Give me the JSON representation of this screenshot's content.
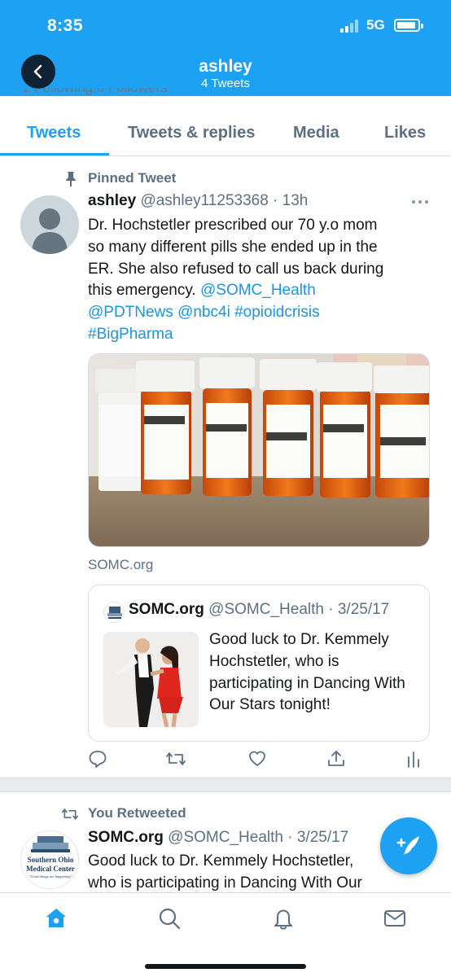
{
  "status": {
    "time": "8:35",
    "network": "5G"
  },
  "header": {
    "name": "ashley",
    "tweet_count": "4 Tweets"
  },
  "profile": {
    "follow_peek": "2 Following  0 Followers"
  },
  "tabs": [
    {
      "label": "Tweets",
      "active": true
    },
    {
      "label": "Tweets & replies",
      "active": false
    },
    {
      "label": "Media",
      "active": false
    },
    {
      "label": "Likes",
      "active": false
    }
  ],
  "pinned_tweet": {
    "pinned_label": "Pinned Tweet",
    "author_name": "ashley",
    "author_handle": "@ashley11253368",
    "time": "13h",
    "text_lines": [
      "Dr. Hochstetler prescribed our 70 y.o mom",
      "so many different pills she ended up in the",
      "ER.  She also refused to call us back during",
      "this emergency."
    ],
    "mentions": [
      "@SOMC_Health",
      "@PDTNews",
      "@nbc4i",
      "#opioidcrisis",
      "#BigPharma"
    ],
    "link_domain": "SOMC.org",
    "quote": {
      "author_name": "SOMC.org",
      "author_handle": "@SOMC_Health",
      "date": "3/25/17",
      "text": "Good luck to Dr. Kemmely Hochstetler, who is participating in Dancing With Our Stars tonight!"
    }
  },
  "retweet": {
    "label": "You Retweeted",
    "author_name": "SOMC.org",
    "author_handle": "@SOMC_Health",
    "date": "3/25/17",
    "text": "Good luck to Dr. Kemmely Hochstetler, who is participating in Dancing With Our Stars",
    "avatar_text_line1": "Southern Ohio",
    "avatar_text_line2": "Medical Center",
    "avatar_tagline": "\"Good things are happening\""
  },
  "colors": {
    "accent": "#1da1f2",
    "link": "#1b95e0",
    "muted": "#5b7083"
  }
}
